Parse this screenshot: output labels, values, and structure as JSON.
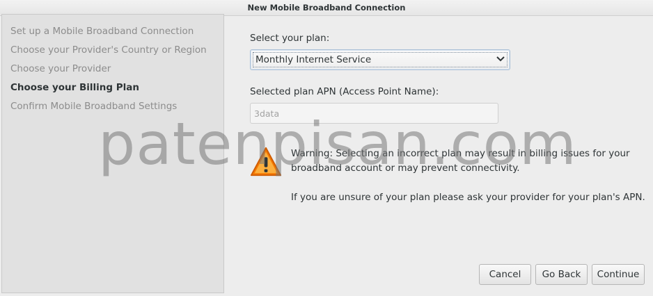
{
  "window": {
    "title": "New Mobile Broadband Connection"
  },
  "sidebar": {
    "steps": [
      {
        "label": "Set up a Mobile Broadband Connection",
        "active": false
      },
      {
        "label": "Choose your Provider's Country or Region",
        "active": false
      },
      {
        "label": "Choose your Provider",
        "active": false
      },
      {
        "label": "Choose your Billing Plan",
        "active": true
      },
      {
        "label": "Confirm Mobile Broadband Settings",
        "active": false
      }
    ]
  },
  "plan": {
    "label": "Select your plan:",
    "selected": "Monthly Internet Service"
  },
  "apn": {
    "label": "Selected plan APN (Access Point Name):",
    "value": "3data"
  },
  "warning": {
    "line1": "Warning: Selecting an incorrect plan may result in billing issues for your",
    "line2": "broadband account or may prevent connectivity.",
    "hint": "If you are unsure of your plan please ask your provider for your plan's APN.",
    "icon": "warning-icon",
    "color": "#f57900"
  },
  "buttons": {
    "cancel": "Cancel",
    "back": "Go Back",
    "continue": "Continue"
  },
  "watermark": "patenpisan.com"
}
